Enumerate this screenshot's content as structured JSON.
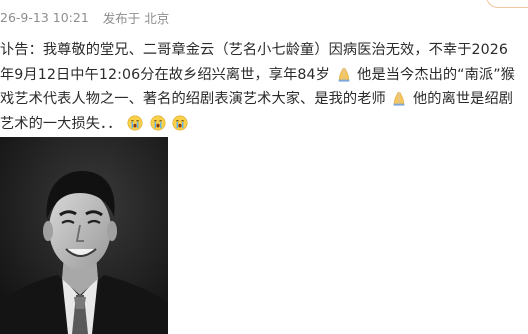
{
  "post": {
    "timestamp": "26-9-13 10:21",
    "source": "发布于 北京",
    "lines": [
      {
        "a": "讣告：我尊敬的堂兄、二哥章金云（艺名小七龄童）因病医治无效，不幸于2026"
      },
      {
        "a": "年9月12日中午12:06分在故乡绍兴离世，享年84岁",
        "b": "他是当今杰出的“南派”猴"
      },
      {
        "a": "戏艺术代表人物之一、著名的绍剧表演艺术大家、是我的老师",
        "b": "他的离世是绍剧"
      },
      {
        "a": "艺术的一大损失．．"
      }
    ]
  },
  "icons": {
    "pray": "pray-emoji-icon",
    "cry": "crying-emoji-icon"
  },
  "colors": {
    "text": "#2b2b2b",
    "meta": "#8e8e8e",
    "photo_bg": "#1b1b1b"
  }
}
